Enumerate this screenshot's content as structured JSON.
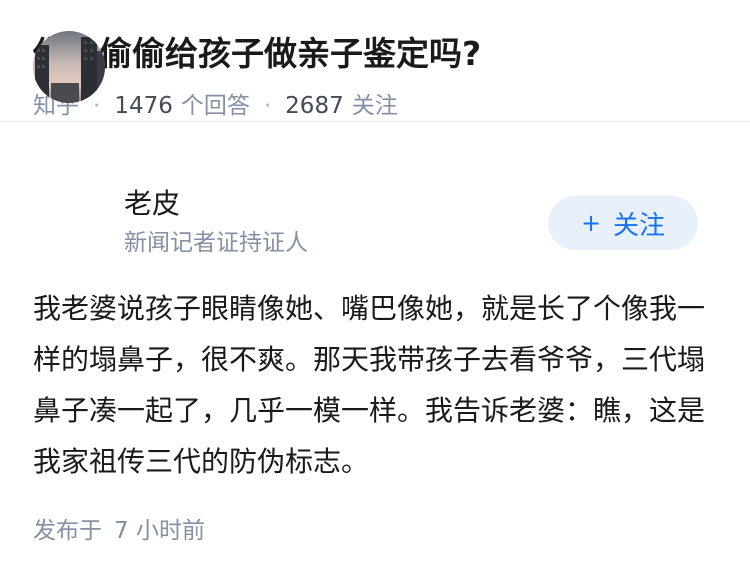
{
  "question": {
    "title": "你会偷偷给孩子做亲子鉴定吗?",
    "source": "知乎",
    "separator": "·",
    "answer_count": "1476",
    "answer_label": "个回答",
    "follower_count": "2687",
    "follower_label": "关注"
  },
  "answer": {
    "author": {
      "name": "老皮",
      "headline": "新闻记者证持证人",
      "avatar_icon": "avatar-city-buildings"
    },
    "follow_button": {
      "icon": "plus-icon",
      "plus": "+",
      "label": "关注"
    },
    "content": "我老婆说孩子眼睛像她、嘴巴像她，就是长了个像我一样的塌鼻子，很不爽。那天我带孩子去看爷爷，三代塌鼻子凑一起了，几乎一模一样。我告诉老婆：瞧，这是我家祖传三代的防伪标志。",
    "published_label": "发布于",
    "published_time": "7 小时前"
  },
  "colors": {
    "title": "#1a1a1a",
    "meta": "#8590a6",
    "accent": "#1772f6",
    "follow_bg": "#e8f1fb"
  }
}
